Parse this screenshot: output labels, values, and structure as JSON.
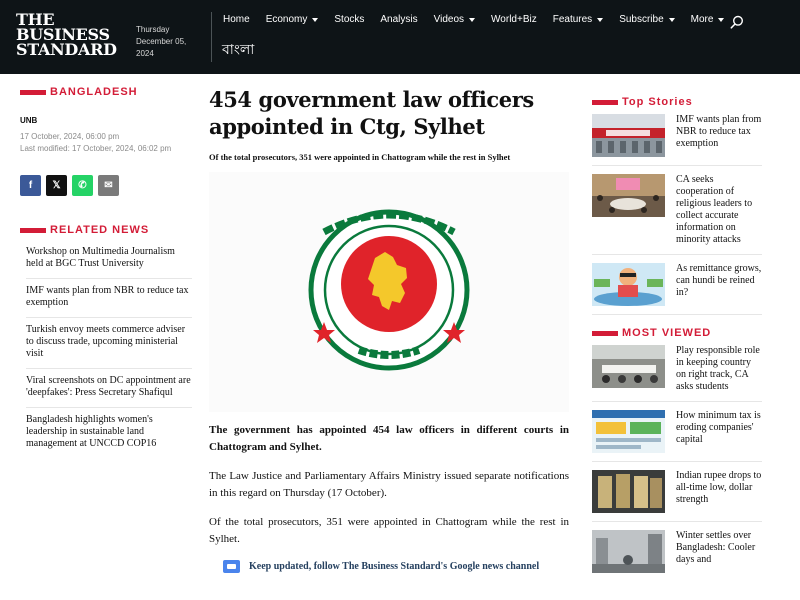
{
  "header": {
    "logo_lines": [
      "THE",
      "BUSINESS",
      "STANDARD"
    ],
    "date_lines": [
      "Thursday",
      "December 05,",
      "2024"
    ],
    "nav": [
      {
        "label": "Home",
        "dropdown": false
      },
      {
        "label": "Economy",
        "dropdown": true
      },
      {
        "label": "Stocks",
        "dropdown": false
      },
      {
        "label": "Analysis",
        "dropdown": false
      },
      {
        "label": "Videos",
        "dropdown": true
      },
      {
        "label": "World+Biz",
        "dropdown": false
      },
      {
        "label": "Features",
        "dropdown": true
      },
      {
        "label": "Subscribe",
        "dropdown": true
      },
      {
        "label": "More",
        "dropdown": true
      }
    ],
    "bangla_label": "বাংলা",
    "search_icon": "search-icon",
    "bg_color": "#0e1417"
  },
  "left": {
    "section": "BANGLADESH",
    "author": "UNB",
    "published": "17 October, 2024, 06:00 pm",
    "modified": "Last modified: 17 October, 2024, 06:02 pm",
    "share": [
      {
        "icon": "facebook-icon",
        "glyph": "f",
        "color": "#3b5998"
      },
      {
        "icon": "x-icon",
        "glyph": "𝕏",
        "color": "#111111"
      },
      {
        "icon": "whatsapp-icon",
        "glyph": "✆",
        "color": "#25d366"
      },
      {
        "icon": "email-icon",
        "glyph": "✉",
        "color": "#7a7a7a"
      }
    ],
    "related_title": "RELATED NEWS",
    "related": [
      "Workshop on Multimedia Journalism held at BGC Trust University",
      "IMF wants plan from NBR to reduce tax exemption",
      "Turkish envoy meets commerce adviser to discuss trade, upcoming ministerial visit",
      "Viral screenshots on DC appointment are 'deepfakes': Press Secretary Shafiqul",
      "Bangladesh highlights women's leadership in sustainable land management at UNCCD COP16"
    ]
  },
  "article": {
    "headline": "454 government law officers appointed in Ctg, Sylhet",
    "subheadline": "Of the total prosecutors, 351 were appointed in Chattogram while the rest in Sylhet",
    "image_alt_icon": "government-emblem-icon",
    "lead": "The government has appointed 454 law officers in different courts in Chattogram and Sylhet.",
    "paragraphs": [
      "The Law Justice and Parliamentary Affairs Ministry issued separate notifications in this regard on Thursday (17 October).",
      "Of the total prosecutors, 351 were appointed in Chattogram while the rest in Sylhet."
    ],
    "gnews_text": "Keep updated, follow The Business Standard's Google news channel"
  },
  "right": {
    "top_title": "Top Stories",
    "top_stories": [
      {
        "title": "IMF wants plan from NBR to reduce tax exemption",
        "thumb": "building-photo"
      },
      {
        "title": "CA seeks cooperation of religious leaders to collect accurate information on minority attacks",
        "thumb": "meeting-photo"
      },
      {
        "title": "As remittance grows, can hundi be reined in?",
        "thumb": "cartoon-illustration"
      }
    ],
    "most_viewed_title": "MOST VIEWED",
    "most_viewed": [
      {
        "title": "Play responsible role in keeping country on right track, CA asks students",
        "thumb": "meeting-photo"
      },
      {
        "title": "How minimum tax is eroding companies' capital",
        "thumb": "infographic"
      },
      {
        "title": "Indian rupee drops to all-time low, dollar strength",
        "thumb": "currency-photo"
      },
      {
        "title": "Winter settles over Bangladesh: Cooler days and",
        "thumb": "street-photo"
      }
    ]
  },
  "colors": {
    "accent": "#d31c37",
    "emblem_green": "#0a7a3c",
    "emblem_red": "#e0232a",
    "emblem_yellow": "#f4c82b"
  }
}
